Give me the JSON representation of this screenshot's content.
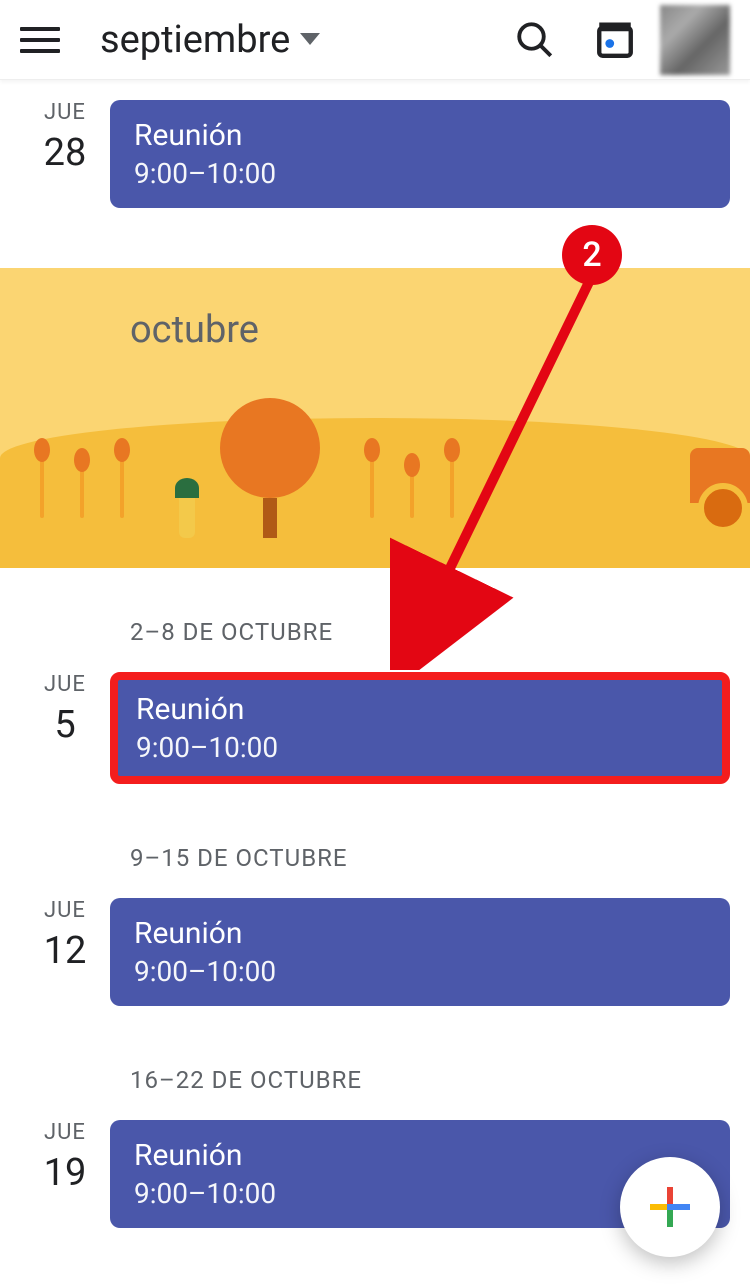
{
  "header": {
    "month_label": "septiembre"
  },
  "top_event": {
    "dow": "JUE",
    "day": "28",
    "title": "Reunión",
    "time": "9:00–10:00"
  },
  "month_banner": {
    "label": "octubre"
  },
  "annotation": {
    "badge": "2"
  },
  "weeks": [
    {
      "header": "2–8 DE OCTUBRE",
      "dow": "JUE",
      "day": "5",
      "title": "Reunión",
      "time": "9:00–10:00",
      "highlighted": true
    },
    {
      "header": "9–15 DE OCTUBRE",
      "dow": "JUE",
      "day": "12",
      "title": "Reunión",
      "time": "9:00–10:00",
      "highlighted": false
    },
    {
      "header": "16–22 DE OCTUBRE",
      "dow": "JUE",
      "day": "19",
      "title": "Reunión",
      "time": "9:00–10:00",
      "highlighted": false
    }
  ]
}
